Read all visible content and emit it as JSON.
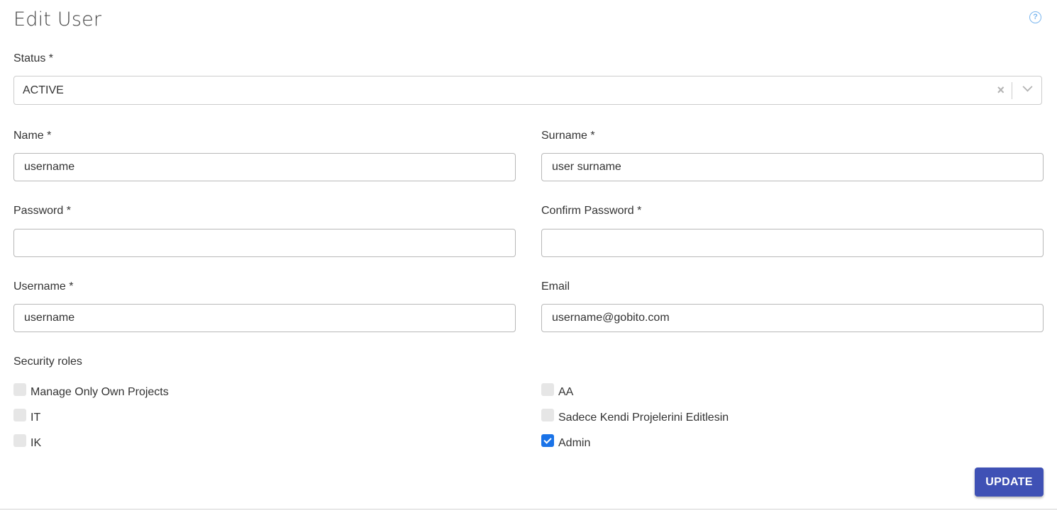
{
  "page": {
    "title": "Edit User",
    "help_icon": "help-circle-icon"
  },
  "status": {
    "label": "Status *",
    "value": "ACTIVE",
    "clear_icon": "×"
  },
  "fields": {
    "name": {
      "label": "Name *",
      "value": "username"
    },
    "surname": {
      "label": "Surname *",
      "value": "user surname"
    },
    "password": {
      "label": "Password *",
      "value": ""
    },
    "confirm_password": {
      "label": "Confirm Password *",
      "value": ""
    },
    "username": {
      "label": "Username *",
      "value": "username"
    },
    "email": {
      "label": "Email",
      "value": "username@gobito.com"
    }
  },
  "security_roles": {
    "label": "Security roles",
    "items": [
      {
        "label": "Manage Only Own Projects",
        "checked": false
      },
      {
        "label": "AA",
        "checked": false
      },
      {
        "label": "IT",
        "checked": false
      },
      {
        "label": "Sadece Kendi Projelerini Editlesin",
        "checked": false
      },
      {
        "label": "IK",
        "checked": false
      },
      {
        "label": "Admin",
        "checked": true
      }
    ]
  },
  "actions": {
    "update_label": "UPDATE",
    "update_color": "#3f51b5"
  }
}
